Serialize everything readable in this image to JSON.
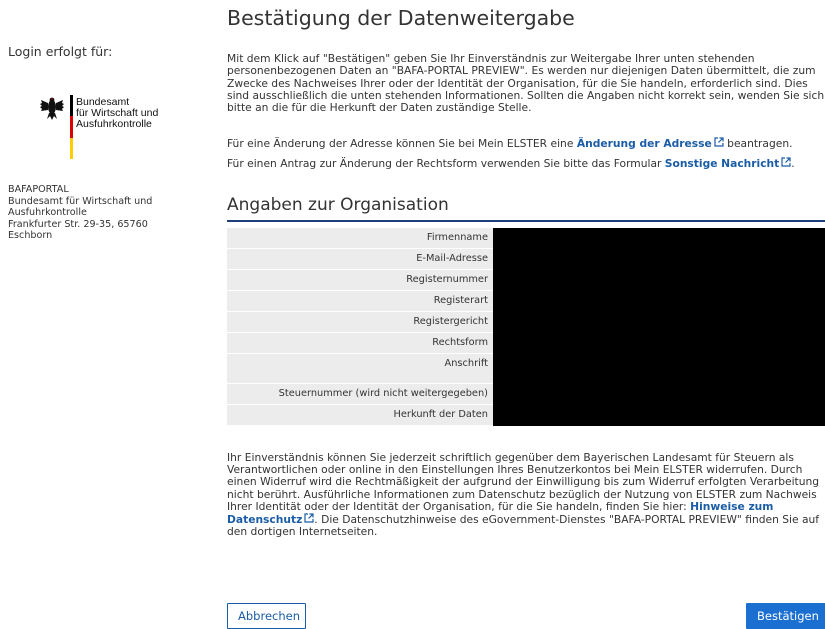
{
  "sidebar": {
    "login_label": "Login erfolgt für:",
    "logo_lines": [
      "Bundesamt",
      "für Wirtschaft und",
      "Ausfuhrkontrolle"
    ],
    "address_lines": [
      "BAFAPORTAL",
      "Bundesamt für Wirtschaft und",
      "Ausfuhrkontrolle",
      "Frankfurter Str. 29-35, 65760",
      "Eschborn"
    ]
  },
  "main": {
    "title": "Bestätigung der Datenweitergabe",
    "intro": "Mit dem Klick auf \"Bestätigen\" geben Sie Ihr Einverständnis zur Weitergabe Ihrer unten stehenden personenbezogenen Daten an \"BAFA-PORTAL PREVIEW\". Es werden nur diejenigen Daten übermittelt, die zum Zwecke des Nachweises Ihrer oder der Identität der Organisation, für die Sie handeln, erforderlich sind. Dies sind ausschließlich die unten stehenden Informationen. Sollten die Angaben nicht korrekt sein, wenden Sie sich bitte an die für die Herkunft der Daten zuständige Stelle.",
    "address_change": {
      "before": "Für eine Änderung der Adresse können Sie bei Mein ELSTER eine ",
      "link": "Änderung der Adresse",
      "after": " beantragen."
    },
    "legal_form_change": {
      "before": "Für einen Antrag zur Änderung der Rechtsform verwenden Sie bitte das Formular ",
      "link": "Sonstige Nachricht",
      "after": "."
    },
    "section_title": "Angaben zur Organisation",
    "fields": [
      "Firmenname",
      "E-Mail-Adresse",
      "Registernummer",
      "Registerart",
      "Registergericht",
      "Rechtsform",
      "Anschrift",
      "Steuernummer (wird nicht weitergegeben)",
      "Herkunft der Daten"
    ],
    "footer": {
      "before": "Ihr Einverständnis können Sie jederzeit schriftlich gegenüber dem Bayerischen Landesamt für Steuern als Verantwortlichen oder online in den Einstellungen Ihres Benutzerkontos bei Mein ELSTER widerrufen. Durch einen Widerruf wird die Rechtmäßigkeit der aufgrund der Einwilligung bis zum Widerruf erfolgten Verarbeitung nicht berührt. Ausführliche Informationen zum Datenschutz bezüglich der Nutzung von ELSTER zum Nachweis Ihrer Identität oder der Identität der Organisation, für die Sie handeln, finden Sie hier: ",
      "link": "Hinweise zum Datenschutz",
      "after": ". Die Datenschutzhinweise des eGovernment-Dienstes \"BAFA-PORTAL PREVIEW\" finden Sie auf den dortigen Internetseiten."
    },
    "buttons": {
      "cancel": "Abbrechen",
      "confirm": "Bestätigen"
    }
  },
  "colors": {
    "link": "#1a5ca6",
    "primary_button": "#1a6fd0",
    "section_rule": "#1f3f7a",
    "label_cell": "#ececec",
    "flag": [
      "#000000",
      "#dd0000",
      "#ffcc00"
    ]
  },
  "icons": {
    "external_link": "external-link-icon",
    "federal_eagle": "federal-eagle-icon"
  }
}
